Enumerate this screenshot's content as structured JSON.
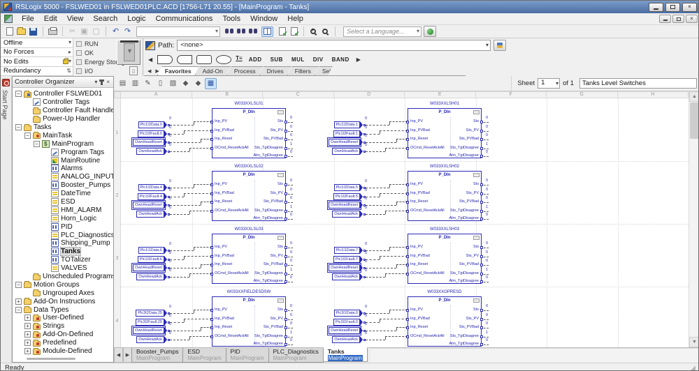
{
  "window": {
    "title": "RSLogix 5000 - FSLWED01 in FSLWED01PLC.ACD [1756-L71 20.55] - [MainProgram - Tanks]"
  },
  "menu": {
    "items": [
      "File",
      "Edit",
      "View",
      "Search",
      "Logic",
      "Communications",
      "Tools",
      "Window",
      "Help"
    ]
  },
  "toolbar": {
    "language_combo": "Select a Language..."
  },
  "status_panel": {
    "rows": [
      "Offline",
      "No Forces",
      "No Edits",
      "Redundancy"
    ],
    "checks": [
      "RUN",
      "OK",
      "Energy Storage",
      "I/O"
    ]
  },
  "path_bar": {
    "label": "Path:",
    "value": "<none>"
  },
  "palette": {
    "text_buttons": [
      "ADD",
      "SUB",
      "MUL",
      "DIV",
      "BAND"
    ],
    "tabs": [
      "Favorites",
      "Add-On",
      "Process",
      "Drives",
      "Filters",
      "Sel"
    ],
    "active_tab": "Favorites"
  },
  "start_page": {
    "label": "Start Page"
  },
  "organizer": {
    "title": "Controller Organizer",
    "items": [
      {
        "label": "Controller FSLWED01",
        "icon": "controller",
        "depth": 0,
        "exp": "-"
      },
      {
        "label": "Controller Tags",
        "icon": "tags",
        "depth": 1
      },
      {
        "label": "Controller Fault Handler",
        "icon": "folder",
        "depth": 1
      },
      {
        "label": "Power-Up Handler",
        "icon": "folder",
        "depth": 1
      },
      {
        "label": "Tasks",
        "icon": "folder",
        "depth": 0,
        "exp": "-"
      },
      {
        "label": "MainTask",
        "icon": "task",
        "depth": 1,
        "exp": "-"
      },
      {
        "label": "MainProgram",
        "icon": "program",
        "depth": 2,
        "exp": "-"
      },
      {
        "label": "Program Tags",
        "icon": "tags",
        "depth": 3
      },
      {
        "label": "MainRoutine",
        "icon": "routine-main",
        "depth": 3
      },
      {
        "label": "Alarms",
        "icon": "routine-fbd",
        "depth": 3
      },
      {
        "label": "ANALOG_INPUT",
        "icon": "routine-ladder",
        "depth": 3
      },
      {
        "label": "Booster_Pumps",
        "icon": "routine-fbd",
        "depth": 3
      },
      {
        "label": "DateTime",
        "icon": "routine-ladder",
        "depth": 3
      },
      {
        "label": "ESD",
        "icon": "routine-ladder",
        "depth": 3
      },
      {
        "label": "HMI_ALARM",
        "icon": "routine-ladder",
        "depth": 3
      },
      {
        "label": "Horn_Logic",
        "icon": "routine-ladder",
        "depth": 3
      },
      {
        "label": "PID",
        "icon": "routine-fbd",
        "depth": 3
      },
      {
        "label": "PLC_Diagnostics",
        "icon": "routine-ladder",
        "depth": 3
      },
      {
        "label": "Shipping_Pump",
        "icon": "routine-fbd",
        "depth": 3
      },
      {
        "label": "Tanks",
        "icon": "routine-fbd",
        "depth": 3,
        "sel": true
      },
      {
        "label": "TOTalizer",
        "icon": "routine-fbd",
        "depth": 3
      },
      {
        "label": "VALVES",
        "icon": "routine-ladder",
        "depth": 3
      },
      {
        "label": "Unscheduled Programs",
        "icon": "folder",
        "depth": 1
      },
      {
        "label": "Motion Groups",
        "icon": "folder",
        "depth": 0,
        "exp": "-"
      },
      {
        "label": "Ungrouped Axes",
        "icon": "folder",
        "depth": 1
      },
      {
        "label": "Add-On Instructions",
        "icon": "folder",
        "depth": 0,
        "exp": "+"
      },
      {
        "label": "Data Types",
        "icon": "folder",
        "depth": 0,
        "exp": "-"
      },
      {
        "label": "User-Defined",
        "icon": "datatype",
        "depth": 1,
        "exp": "+"
      },
      {
        "label": "Strings",
        "icon": "datatype",
        "depth": 1,
        "exp": "+"
      },
      {
        "label": "Add-On-Defined",
        "icon": "datatype",
        "depth": 1,
        "exp": "+"
      },
      {
        "label": "Predefined",
        "icon": "datatype",
        "depth": 1,
        "exp": "+"
      },
      {
        "label": "Module-Defined",
        "icon": "datatype",
        "depth": 1,
        "exp": "+"
      }
    ]
  },
  "sheet_bar": {
    "label": "Sheet",
    "number": "1",
    "of_label": "of 1",
    "description": "Tanks Level Switches"
  },
  "ruler": {
    "columns": [
      "A",
      "B",
      "C",
      "D",
      "E",
      "F",
      "G",
      "H"
    ],
    "rows": [
      "1",
      "2",
      "3",
      "4"
    ]
  },
  "fbd": {
    "block_type": "P_DIn",
    "inputs": [
      "Inp_PV",
      "Inp_PVBad",
      "Inp_Reset",
      "OCmd_ResetAckAll"
    ],
    "outputs": [
      "Sts",
      "Sts_PV",
      "Sts_PVBad",
      "Sts_TgtDisagree",
      "Alm_TgtDisagree"
    ],
    "output_values": [
      "0",
      "0",
      "0",
      "1",
      "0"
    ],
    "input_values": [
      "0",
      "0",
      "0",
      "0"
    ],
    "blocks": [
      {
        "title": "W033XXLSL01",
        "row": 0,
        "col": 0,
        "tags": [
          "Plc1I2Data.0",
          "Plc1I2Fault.0",
          "OwnHeadReset",
          "OwnHeadAck"
        ]
      },
      {
        "title": "W033XXLSH01",
        "row": 0,
        "col": 1,
        "tags": [
          "Plc1I2Data.1",
          "Plc1I2Fault.1",
          "OwnHeadReset",
          "OwnHeadAck"
        ]
      },
      {
        "title": "W033XXLSL02",
        "row": 1,
        "col": 0,
        "tags": [
          "Plc1I2Data.4",
          "Plc1I2Fault.4",
          "OwnHeadReset",
          "OwnHeadAck"
        ]
      },
      {
        "title": "W033XXLSH02",
        "row": 1,
        "col": 1,
        "tags": [
          "Plc1I2Data.5",
          "Plc1I2Fault.5",
          "OwnHeadReset",
          "OwnHeadAck"
        ]
      },
      {
        "title": "W033XXLSL03",
        "row": 2,
        "col": 0,
        "tags": [
          "Plc1I1Data.6",
          "Plc1I1Fault.6",
          "OwnHeadReset",
          "OwnHeadAck"
        ]
      },
      {
        "title": "W033XXLSH03",
        "row": 2,
        "col": 1,
        "tags": [
          "Plc1I1Data.7",
          "Plc1I1Fault.7",
          "OwnHeadReset",
          "OwnHeadAck"
        ]
      },
      {
        "title": "W033XXFIELDESDSW",
        "row": 3,
        "col": 0,
        "tags": [
          "Plc3I2Data.25",
          "Plc3I2Fault.25",
          "OwnHeadReset",
          "OwnHeadAck"
        ]
      },
      {
        "title": "W033XXOPRESD",
        "row": 3,
        "col": 1,
        "tags": [
          "Plc3I1Data.0",
          "Plc3I1Fault.0",
          "OwnHeadReset",
          "OwnHeadAck"
        ]
      }
    ]
  },
  "bottom_tabs": {
    "tabs": [
      {
        "name": "Booster_Pumps",
        "sub": "MainProgram",
        "active": false
      },
      {
        "name": "ESD",
        "sub": "MainProgram",
        "active": false
      },
      {
        "name": "PID",
        "sub": "MainProgram",
        "active": false
      },
      {
        "name": "PLC_Diagnostics",
        "sub": "MainProgram",
        "active": false
      },
      {
        "name": "Tanks",
        "sub": "MainProgram",
        "active": true
      }
    ]
  },
  "status_bar": {
    "text": "Ready"
  },
  "colors": {
    "fbd_blue": "#2a2ab8",
    "titlebar": "#4a6da3",
    "selection_blue": "#316ac5"
  }
}
